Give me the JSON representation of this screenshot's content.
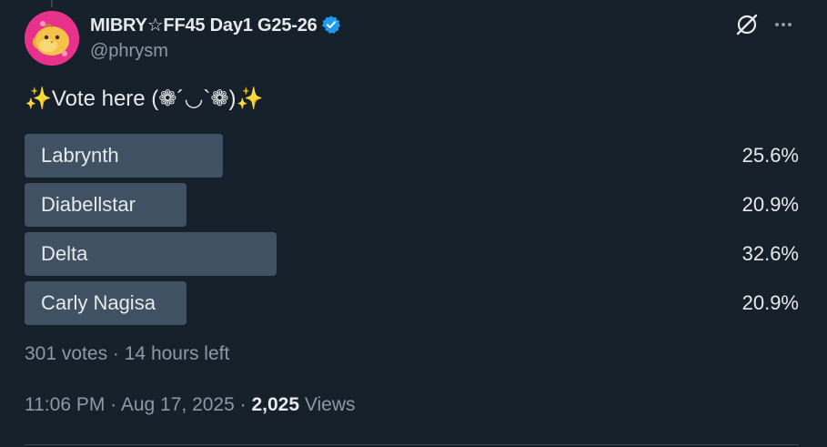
{
  "tweet": {
    "author": {
      "display_name": "MIBRY☆FF45 Day1 G25-26",
      "handle": "@phrysm",
      "verified": true,
      "avatar_icon": "yellow-bird-avatar",
      "avatar_color": "#e8318a"
    },
    "text_prefix_icon": "✨",
    "text": "Vote here (❁´◡`❁)",
    "text_suffix_icon": "✨",
    "poll": {
      "options": [
        {
          "label": "Labrynth",
          "percent_text": "25.6%",
          "percent": 25.6
        },
        {
          "label": "Diabellstar",
          "percent_text": "20.9%",
          "percent": 20.9
        },
        {
          "label": "Delta",
          "percent_text": "32.6%",
          "percent": 32.6
        },
        {
          "label": "Carly Nagisa",
          "percent_text": "20.9%",
          "percent": 20.9
        }
      ],
      "votes_text": "301 votes",
      "separator": " · ",
      "time_left": "14 hours left"
    },
    "time": "11:06 PM",
    "date": "Aug 17, 2025",
    "meta_separator": " · ",
    "views_count": "2,025",
    "views_label": "Views"
  },
  "icons": {
    "verified": "verified-badge-icon",
    "grok": "grok-icon",
    "more": "more-icon"
  },
  "colors": {
    "background": "#15202b",
    "bar": "#3f5162",
    "verified": "#1d9bf0",
    "secondary_text": "#8b98a5"
  }
}
